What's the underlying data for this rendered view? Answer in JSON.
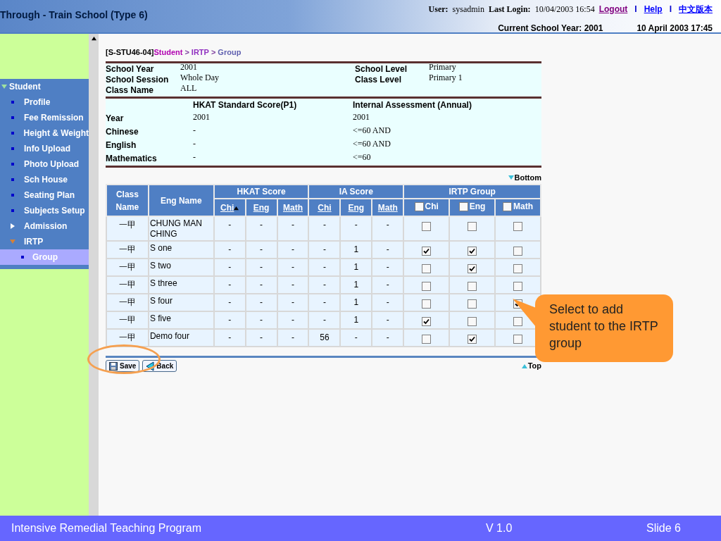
{
  "header": {
    "title": "Through - Train School (Type 6)",
    "user_label": "User:",
    "user": "sysadmin",
    "last_login_label": "Last Login:",
    "last_login": "10/04/2003 16:54",
    "separators": [
      "I",
      "I"
    ],
    "links": [
      "Logout",
      "Help",
      "中文版本"
    ],
    "school_year": "Current School Year: 2001",
    "datetime": "10 April 2003 17:45"
  },
  "sidebar": {
    "items": [
      {
        "label": "Student",
        "expanded": true,
        "children": [
          {
            "label": "Profile"
          },
          {
            "label": "Fee Remission"
          },
          {
            "label": "Height & Weight"
          },
          {
            "label": "Info Upload"
          },
          {
            "label": "Photo Upload"
          },
          {
            "label": "Sch House"
          },
          {
            "label": "Seating Plan"
          },
          {
            "label": "Subjects Setup"
          },
          {
            "label": "Admission",
            "expanded": false
          },
          {
            "label": "IRTP",
            "expanded": true,
            "children": [
              {
                "label": "Group",
                "selected": true
              }
            ]
          }
        ]
      }
    ]
  },
  "breadcrumb": {
    "code": "[S-STU46-04]",
    "separator": ">",
    "path": [
      "Student",
      "IRTP",
      "Group"
    ]
  },
  "info": {
    "left": [
      {
        "label": "School Year",
        "value": "2001"
      },
      {
        "label": "School Session",
        "value": "Whole Day"
      },
      {
        "label": "Class Name",
        "value": "ALL"
      }
    ],
    "right": [
      {
        "label": "School Level",
        "value": "Primary"
      },
      {
        "label": "Class Level",
        "value": "Primary 1"
      }
    ]
  },
  "criteria": {
    "headings": [
      "HKAT Standard Score(P1)",
      "Internal Assessment (Annual)"
    ],
    "rows": [
      {
        "label": "Year",
        "hkat": "2001",
        "ia": "2001"
      },
      {
        "label": "Chinese",
        "hkat": "-",
        "ia": "<=60 AND"
      },
      {
        "label": "English",
        "hkat": "-",
        "ia": "<=60 AND"
      },
      {
        "label": "Mathematics",
        "hkat": "-",
        "ia": "<=60"
      }
    ]
  },
  "bottom_link": "Bottom",
  "table": {
    "class_header": "Class Name",
    "name_header": "Eng Name",
    "groups": [
      {
        "label": "HKAT Score",
        "columns": [
          {
            "label": "Chi",
            "sorted": true
          },
          {
            "label": "Eng",
            "sorted": false
          },
          {
            "label": "Math",
            "sorted": false
          }
        ]
      },
      {
        "label": "IA Score",
        "columns": [
          {
            "label": "Chi",
            "sorted": false
          },
          {
            "label": "Eng",
            "sorted": false
          },
          {
            "label": "Math",
            "sorted": false
          }
        ]
      }
    ],
    "irtp": {
      "label": "IRTP Group",
      "columns": [
        {
          "label": "Chi",
          "checked": false
        },
        {
          "label": "Eng",
          "checked": false
        },
        {
          "label": "Math",
          "checked": false
        }
      ]
    },
    "rows": [
      {
        "class": "一甲",
        "name": "CHUNG MAN CHING",
        "scores": [
          "-",
          "-",
          "-",
          "-",
          "-",
          "-"
        ],
        "irtp": [
          false,
          false,
          false
        ]
      },
      {
        "class": "一甲",
        "name": "S one",
        "scores": [
          "-",
          "-",
          "-",
          "-",
          "1",
          "-"
        ],
        "irtp": [
          true,
          true,
          false
        ]
      },
      {
        "class": "一甲",
        "name": "S two",
        "scores": [
          "-",
          "-",
          "-",
          "-",
          "1",
          "-"
        ],
        "irtp": [
          false,
          true,
          false
        ]
      },
      {
        "class": "一甲",
        "name": "S three",
        "scores": [
          "-",
          "-",
          "-",
          "-",
          "1",
          "-"
        ],
        "irtp": [
          false,
          false,
          false
        ]
      },
      {
        "class": "一甲",
        "name": "S four",
        "scores": [
          "-",
          "-",
          "-",
          "-",
          "1",
          "-"
        ],
        "irtp": [
          false,
          false,
          true
        ]
      },
      {
        "class": "一甲",
        "name": "S five",
        "scores": [
          "-",
          "-",
          "-",
          "-",
          "1",
          "-"
        ],
        "irtp": [
          true,
          false,
          false
        ]
      },
      {
        "class": "一甲",
        "name": "Demo four",
        "scores": [
          "-",
          "-",
          "-",
          "56",
          "-",
          "-"
        ],
        "irtp": [
          false,
          true,
          false
        ]
      }
    ]
  },
  "buttons": [
    "Save",
    "Back"
  ],
  "top_link": "Top",
  "callout": "Select to add student to the IRTP group",
  "footer": {
    "title": "Intensive Remedial Teaching Program",
    "version": "V 1.0",
    "slide": "Slide 6"
  }
}
